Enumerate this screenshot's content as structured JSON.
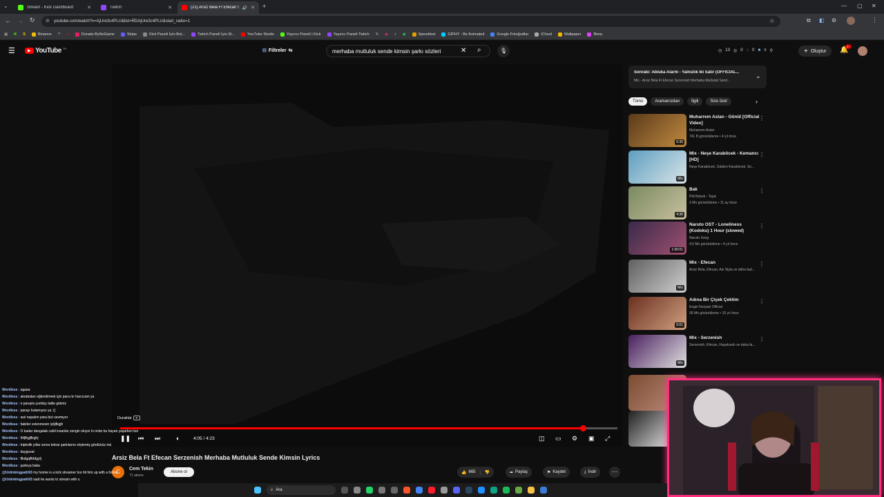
{
  "browser": {
    "tabs": [
      {
        "label": "Stream - Kick Dashboard",
        "color": "#53fc18"
      },
      {
        "label": "Twitch",
        "color": "#9146ff"
      },
      {
        "label": "(21) Arsiz Bela Ft Efecan Se",
        "color": "#ff0000"
      }
    ],
    "new_tab": "+",
    "url": "youtube.com/watch?v=AjUre3c4PLU&list=RDAjUre3c4PLU&start_radio=1",
    "bookmarks": [
      {
        "label": "Binance",
        "color": "#f0b90b"
      },
      {
        "label": "Donate-ByNoGame",
        "color": "#e91e63"
      },
      {
        "label": "Stripe",
        "color": "#635bff"
      },
      {
        "label": "Kick Paneli İçin-Bot...",
        "color": "#888888"
      },
      {
        "label": "Twitch Paneli İçin-St...",
        "color": "#9146ff"
      },
      {
        "label": "YouTube Studio",
        "color": "#ff0000"
      },
      {
        "label": "Yayıncı Paneli | Kick",
        "color": "#53fc18"
      },
      {
        "label": "Yayıncı Paneli-Twitch",
        "color": "#9146ff"
      },
      {
        "label": "Speedtest",
        "color": "#e0a000"
      },
      {
        "label": "GIPHY - Be Animated",
        "color": "#00ccff"
      },
      {
        "label": "Google Fotoğraflar",
        "color": "#4285f4"
      },
      {
        "label": "iCloud",
        "color": "#aaaaaa"
      },
      {
        "label": "Wallpaper",
        "color": "#f5b400"
      },
      {
        "label": "Bierp",
        "color": "#e040fb"
      }
    ]
  },
  "youtube": {
    "logo": "YouTube",
    "logo_sup": "TR",
    "filters": "Filtreler",
    "search_value": "merhaba mutluluk sende kimsin şarkı sözleri",
    "header_stats": [
      "13",
      "0",
      "0"
    ],
    "create": "Oluştur",
    "notif_count": "9+"
  },
  "player": {
    "pause_tooltip": "Duraklat",
    "pause_key": "K",
    "time": "4:05 / 4:23",
    "progress": 0.93,
    "video_title": "Arsiz Bela Ft Efecan Serzenish Merhaba Mutluluk Sende Kimsin Lyrics",
    "channel": "Cem Tekin",
    "channel_initial": "C",
    "subscribers": "71 abone",
    "subscribe": "Abone ol",
    "likes": "665",
    "share": "Paylaş",
    "save": "Kaydet",
    "download": "İndir"
  },
  "sidebar": {
    "next_label": "Sonraki: Abluka Alarm - Yalnızlık İki Satır (OFFICIAL...",
    "next_sub": "Mix - Arsiz Bela Ft Efecan Serzenish Merhaba Mutluluk Send...",
    "chips": [
      "Tümü",
      "Aramanızdan",
      "İlgili",
      "Size özel"
    ],
    "recs": [
      {
        "title": "Muharrem Aslan - Gönül [Official Video]",
        "meta1": "Muharrem Aslan",
        "meta2": "741 B görüntüleme • 4 yıl önce",
        "dur": "5:30",
        "c1": "#5a3a1a",
        "c2": "#c08a40"
      },
      {
        "title": "Mix - Neşe Karaböcek - Kemancı [HD]",
        "meta1": "Neşe Karaböcek, Gülden Karaböcek, Se...",
        "meta2": "",
        "dur": "Mix",
        "c1": "#5e9fc0",
        "c2": "#d8e4e8"
      },
      {
        "title": "Bak",
        "meta1": "Pilli Bebek - Topic",
        "meta2": "2 Mn görüntüleme • 11 ay önce",
        "dur": "4:36",
        "c1": "#7a8a60",
        "c2": "#c8c0a0"
      },
      {
        "title": "Naruto OST - Loneliness (Kodoku) 1 Hour (slowed)",
        "meta1": "Naruto Song",
        "meta2": "4,5 Mn görüntüleme • 4 yıl önce",
        "dur": "1:00:01",
        "c1": "#3a2a4a",
        "c2": "#a05070"
      },
      {
        "title": "Mix - Efecan",
        "meta1": "Arsiz Bela, Efecan, Asi Styla ve daha fazl...",
        "meta2": "",
        "dur": "Mix",
        "c1": "#606060",
        "c2": "#cfcfcf"
      },
      {
        "title": "Adına Bir Çiçek Çektim",
        "meta1": "Engin Nurşani Official",
        "meta2": "39 Mn görüntüleme • 10 yıl önce",
        "dur": "5:01",
        "c1": "#6a3020",
        "c2": "#d0a080"
      },
      {
        "title": "Mix - Serzenish",
        "meta1": "Serzenish, Efecan, Hayalcash ve daha fa...",
        "meta2": "",
        "dur": "Mix",
        "c1": "#4a2060",
        "c2": "#e0e0e0"
      },
      {
        "title": "",
        "meta1": "",
        "meta2": "",
        "dur": "",
        "c1": "#7a4a30",
        "c2": "#c09080"
      },
      {
        "title": "",
        "meta1": "",
        "meta2": "",
        "dur": "",
        "c1": "#202020",
        "c2": "#ffffff"
      }
    ]
  },
  "chat": [
    {
      "user": "Wordless",
      "msg": ": agaaa"
    },
    {
      "user": "Wordless",
      "msg": ": akrabaları eğlendirmek için para mı harcıcam ya"
    },
    {
      "user": "Wordless",
      "msg": ": o parayla yurtdışı tatile gideriz"
    },
    {
      "user": "Wordless",
      "msg": ": parayı bulamıyoz ya :(("
    },
    {
      "user": "Wordless",
      "msg": ": asıl napalım para bizi sevmiyor"
    },
    {
      "user": "Wordless",
      "msg": ": fakirler evlenmesin iyiljifkgjh"
    },
    {
      "user": "Wordless",
      "msg": ": O kadar dangalak cahil insanlar zengin oluyor ki onlar bu hayatı yaşarken ben hala mı yapıyorum diyorum"
    },
    {
      "user": "Wordless",
      "msg": ": lhfjfkgjflkghj"
    },
    {
      "user": "Wordless",
      "msg": ": tripkolik yıllar sonra tekrar şarkılarını söylemiş gördünüz mü"
    },
    {
      "user": "Wordless",
      "msg": ": duygusal"
    },
    {
      "user": "Wordless",
      "msg": ": flkdgqlfkfdgyfj"
    },
    {
      "user": "Wordless",
      "msg": ": şarkıya baka"
    },
    {
      "user": "@Unlinkingpath93",
      "msg": "my homie is a kick streamer too hit him up with a follow"
    },
    {
      "user": "@Unlinkingpath93",
      "msg": "said he wants to stream with u"
    }
  ],
  "taskbar": {
    "search": "Ara"
  }
}
